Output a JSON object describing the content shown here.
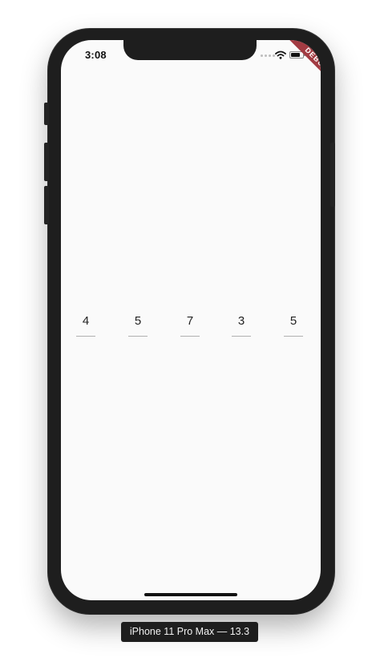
{
  "status_bar": {
    "time": "3:08",
    "signal_icon": "signal-dots-icon",
    "wifi_icon": "wifi-icon",
    "battery_icon": "battery-icon"
  },
  "debug_banner": {
    "label": "DEBUG",
    "color": "#a23b42"
  },
  "digit_fields": [
    {
      "value": "4"
    },
    {
      "value": "5"
    },
    {
      "value": "7"
    },
    {
      "value": "3"
    },
    {
      "value": "5"
    }
  ],
  "device_label": "iPhone 11 Pro Max — 13.3",
  "colors": {
    "screen_background": "#fafafa",
    "bezel": "#1e1e1e",
    "underline": "#b0b0b0"
  }
}
